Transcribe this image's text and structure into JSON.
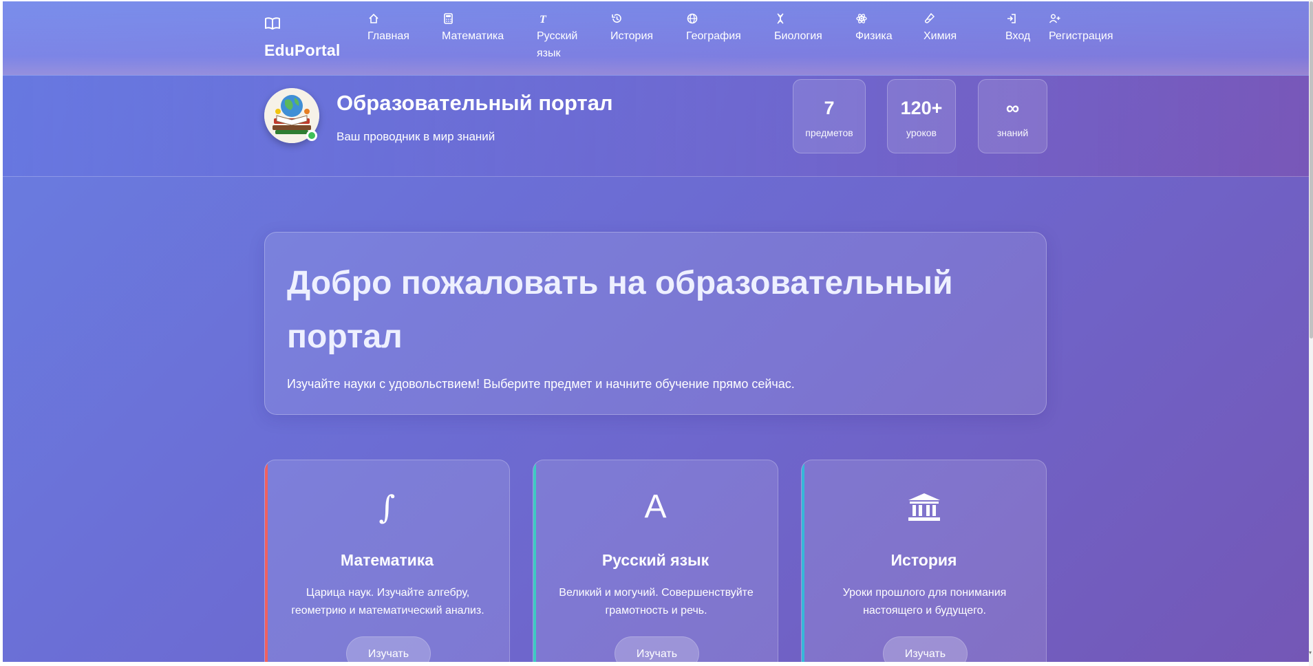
{
  "brand": {
    "name": "EduPortal",
    "icon": "open-book-icon"
  },
  "nav": [
    {
      "label": "Главная",
      "icon": "home-icon"
    },
    {
      "label": "Математика",
      "icon": "calculator-icon"
    },
    {
      "label": "Русский язык",
      "icon": "text-icon"
    },
    {
      "label": "История",
      "icon": "history-icon"
    },
    {
      "label": "География",
      "icon": "globe-icon"
    },
    {
      "label": "Биология",
      "icon": "dna-icon"
    },
    {
      "label": "Физика",
      "icon": "atom-icon"
    },
    {
      "label": "Химия",
      "icon": "flask-icon"
    },
    {
      "label": "Вход",
      "icon": "login-icon"
    },
    {
      "label": "Регистрация",
      "icon": "user-plus-icon"
    }
  ],
  "header": {
    "title": "Образовательный портал",
    "subtitle": "Ваш проводник в мир знаний",
    "stats": [
      {
        "value": "7",
        "label": "предметов"
      },
      {
        "value": "120+",
        "label": "уроков"
      },
      {
        "value": "∞",
        "label": "знаний"
      }
    ]
  },
  "welcome": {
    "title": "Добро пожаловать на образовательный портал",
    "text": "Изучайте науки с удовольствием! Выберите предмет и начните обучение прямо сейчас."
  },
  "cards": [
    {
      "title": "Математика",
      "icon": "integral-icon",
      "glyph": "∫",
      "text": "Царица наук. Изучайте алгебру, геометрию и математический анализ.",
      "button": "Изучать",
      "accent": "#f0605f"
    },
    {
      "title": "Русский язык",
      "icon": "letter-a-icon",
      "glyph": "A",
      "text": "Великий и могучий. Совершенствуйте грамотность и речь.",
      "button": "Изучать",
      "accent": "#3ec9c2"
    },
    {
      "title": "История",
      "icon": "museum-icon",
      "glyph": "",
      "text": "Уроки прошлого для понимания настоящего и будущего.",
      "button": "Изучать",
      "accent": "#36b8d8"
    }
  ],
  "colors": {
    "online": "#3fbf5a"
  }
}
